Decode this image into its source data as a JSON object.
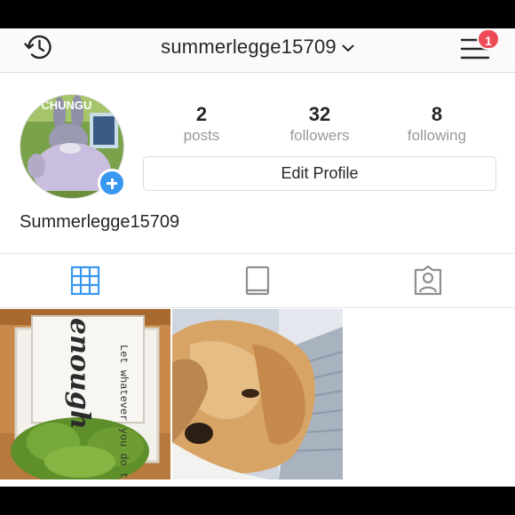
{
  "header": {
    "username": "summerlegge15709",
    "notification_count": "1",
    "history_icon": "history-icon",
    "menu_icon": "hamburger-menu-icon",
    "dropdown_icon": "chevron-down-icon"
  },
  "profile": {
    "avatar_caption": "IG CHUNGU",
    "posts_count": "2",
    "posts_label": "posts",
    "followers_count": "32",
    "followers_label": "followers",
    "following_count": "8",
    "following_label": "following",
    "edit_profile_label": "Edit Profile",
    "display_name": "Summerlegge15709"
  },
  "tabs": [
    {
      "icon": "grid-icon",
      "active": true
    },
    {
      "icon": "feed-icon",
      "active": false
    },
    {
      "icon": "tagged-person-icon",
      "active": false
    }
  ],
  "posts": [
    {
      "sign_text": "Let whatever you do today be",
      "script_text": "enough"
    },
    {
      "subject": "golden retriever photo"
    }
  ],
  "colors": {
    "accent_blue": "#3897f0",
    "badge_red": "#ed4956",
    "muted_text": "#999999",
    "active_tab": "#3897f0"
  }
}
